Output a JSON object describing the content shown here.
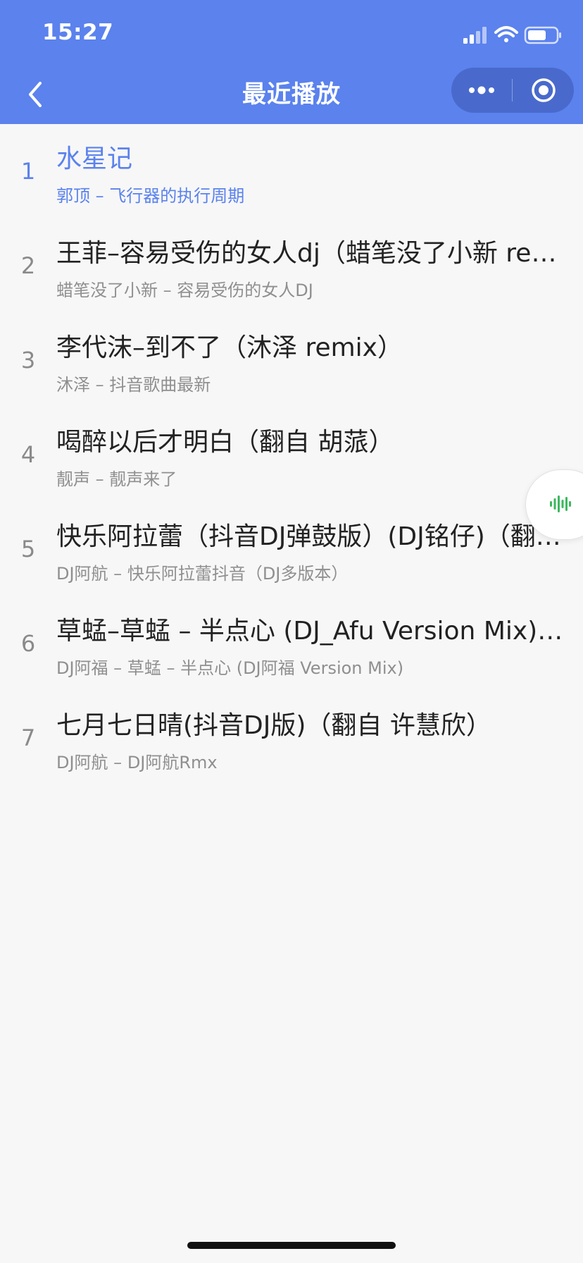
{
  "status_bar": {
    "time": "15:27",
    "icons": [
      "signal-icon",
      "wifi-icon",
      "battery-icon"
    ]
  },
  "nav": {
    "title": "最近播放",
    "back_icon": "chevron-left-icon",
    "menu_icon": "more-dots-icon",
    "close_icon": "target-circle-icon"
  },
  "songs": [
    {
      "index": "1",
      "title": "水星记",
      "subtitle": "郭顶 – 飞行器的执行周期",
      "active": true
    },
    {
      "index": "2",
      "title": "王菲–容易受伤的女人dj（蜡笔没了小新 re…",
      "subtitle": "蜡笔没了小新 – 容易受伤的女人DJ",
      "active": false
    },
    {
      "index": "3",
      "title": "李代沫–到不了（沐泽 remix）",
      "subtitle": "沐泽 – 抖音歌曲最新",
      "active": false
    },
    {
      "index": "4",
      "title": "喝醉以后才明白（翻自 胡蒎）",
      "subtitle": "靓声 – 靓声来了",
      "active": false
    },
    {
      "index": "5",
      "title": "快乐阿拉蕾（抖音DJ弹鼓版）(DJ铭仔)（翻…",
      "subtitle": "DJ阿航 – 快乐阿拉蕾抖音（DJ多版本）",
      "active": false
    },
    {
      "index": "6",
      "title": "草蜢–草蜢 – 半点心 (DJ_Afu Version Mix)…",
      "subtitle": "DJ阿福 – 草蜢 – 半点心 (DJ阿福 Version Mix)",
      "active": false
    },
    {
      "index": "7",
      "title": "七月七日晴(抖音DJ版)（翻自 许慧欣）",
      "subtitle": "DJ阿航 – DJ阿航Rmx",
      "active": false
    }
  ],
  "floating_player": {
    "icon": "audio-wave-icon"
  },
  "colors": {
    "accent": "#5b82ed",
    "background": "#f7f7f7",
    "title_text": "#222222",
    "subtitle_text": "#8f8f8f",
    "wave_green": "#3cb95e"
  }
}
